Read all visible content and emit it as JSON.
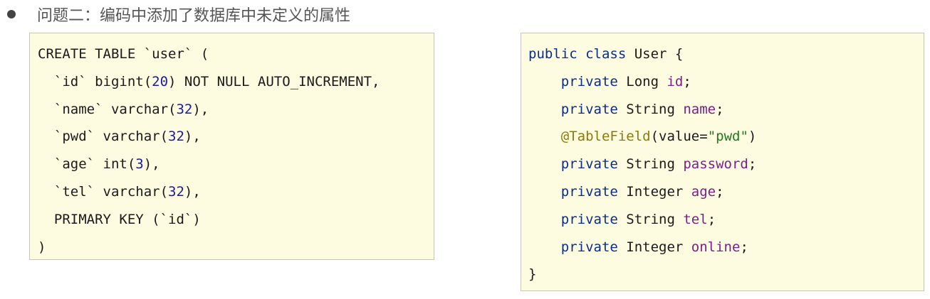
{
  "heading": {
    "text": "问题二：编码中添加了数据库中未定义的属性"
  },
  "colors": {
    "box_background": "#fdfbe0",
    "box_border": "#c9c7b0",
    "number": "#1a1aa6",
    "keyword": "#0a2d8c",
    "field": "#7a1f8c",
    "annotation": "#8a7a10",
    "string": "#1f7a1f"
  },
  "sql": {
    "line1": "CREATE TABLE `user` (",
    "line2_pre": "  `id` bigint(",
    "line2_num": "20",
    "line2_post": ") NOT NULL AUTO_INCREMENT,",
    "line3_pre": "  `name` varchar(",
    "line3_num": "32",
    "line3_post": "),",
    "line4_pre": "  `pwd` varchar(",
    "line4_num": "32",
    "line4_post": "),",
    "line5_pre": "  `age` int(",
    "line5_num": "3",
    "line5_post": "),",
    "line6_pre": "  `tel` varchar(",
    "line6_num": "32",
    "line6_post": "),",
    "line7": "  PRIMARY KEY (`id`)",
    "line8": ")"
  },
  "java": {
    "class_kw": "public class",
    "class_name": " User {",
    "indent": "    ",
    "private_kw": "private",
    "fields": [
      {
        "type": " Long ",
        "name": "id"
      },
      {
        "type": " String ",
        "name": "name"
      },
      {
        "type": " String ",
        "name": "password"
      },
      {
        "type": " Integer ",
        "name": "age"
      },
      {
        "type": " String ",
        "name": "tel"
      },
      {
        "type": " Integer ",
        "name": "online"
      }
    ],
    "semicolon": ";",
    "annotation": "@TableField",
    "anno_open": "(value=",
    "anno_value": "\"pwd\"",
    "anno_close": ")",
    "closing": "}"
  }
}
